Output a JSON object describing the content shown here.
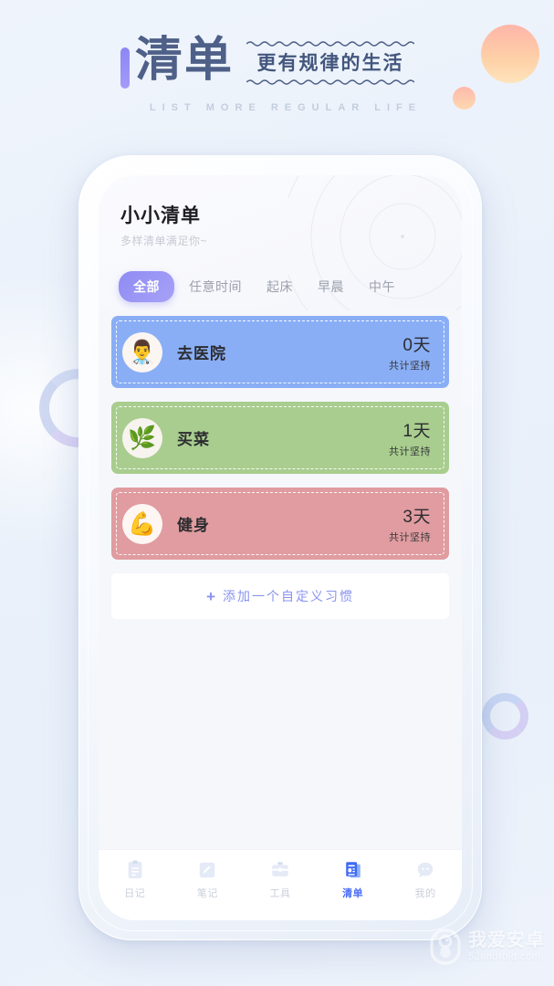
{
  "banner": {
    "bar_icon": "accent-bar",
    "title_cn": "清单",
    "subtitle_cn": "更有规律的生活",
    "subtitle_en": "LIST MORE REGULAR LIFE"
  },
  "app": {
    "title": "小小清单",
    "subtitle": "多样清单满足你~",
    "tabs": [
      {
        "label": "全部",
        "active": true
      },
      {
        "label": "任意时间",
        "active": false
      },
      {
        "label": "起床",
        "active": false
      },
      {
        "label": "早晨",
        "active": false
      },
      {
        "label": "中午",
        "active": false
      }
    ],
    "habits": [
      {
        "name": "去医院",
        "icon": "👨‍⚕️",
        "icon_name": "doctor-emoji",
        "days": "0天",
        "note": "共计坚持",
        "color": "#89aef5",
        "avatar_bg": "#fcf6f3"
      },
      {
        "name": "买菜",
        "icon": "🌿",
        "icon_name": "leaf-emoji",
        "days": "1天",
        "note": "共计坚持",
        "color": "#a8cd8e",
        "avatar_bg": "#f7f3ee"
      },
      {
        "name": "健身",
        "icon": "💪",
        "icon_name": "flexed-biceps-emoji",
        "days": "3天",
        "note": "共计坚持",
        "color": "#e09ca0",
        "avatar_bg": "#fdf6f3"
      }
    ],
    "add_button": {
      "plus": "+",
      "label": "添加一个自定义习惯"
    },
    "bottom_nav": [
      {
        "label": "日记",
        "icon_name": "clipboard-icon",
        "active": false
      },
      {
        "label": "笔记",
        "icon_name": "pencil-note-icon",
        "active": false
      },
      {
        "label": "工具",
        "icon_name": "toolbox-icon",
        "active": false
      },
      {
        "label": "清单",
        "icon_name": "list-document-icon",
        "active": true
      },
      {
        "label": "我的",
        "icon_name": "profile-icon",
        "active": false
      }
    ]
  },
  "watermark": {
    "logo_name": "android-robot-logo",
    "cn": "我爱安卓",
    "en": "52android.com"
  },
  "colors": {
    "accent_purple": "#8f8cf3",
    "nav_active_blue": "#4a6cf7",
    "banner_text": "#4e6088",
    "page_bg": "#eef3fb"
  }
}
